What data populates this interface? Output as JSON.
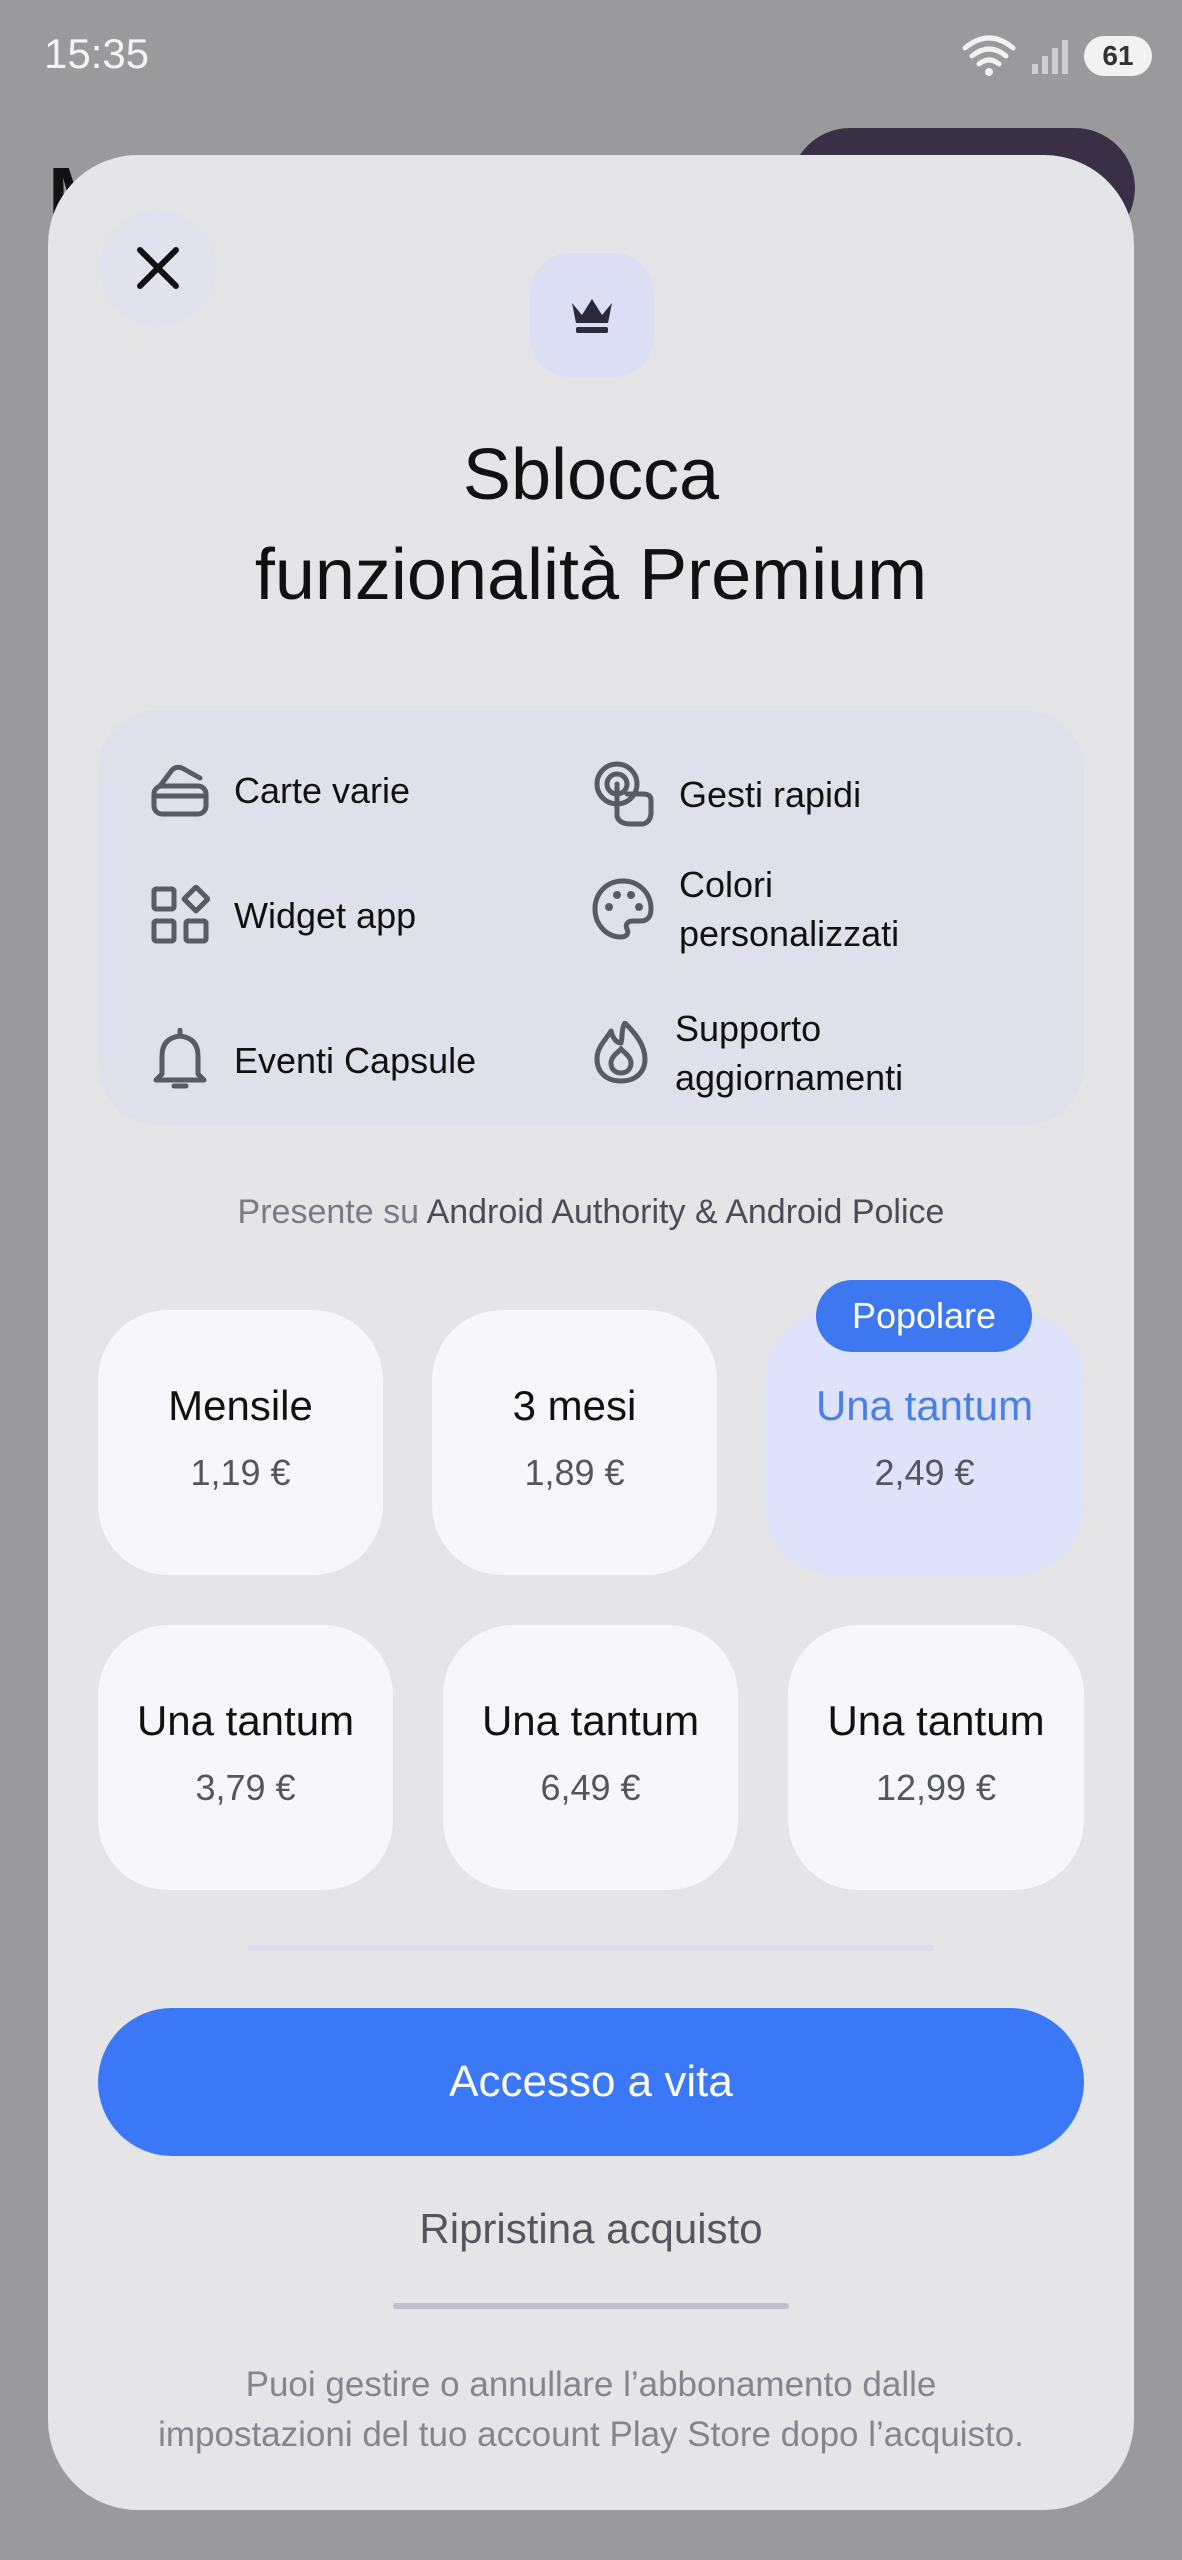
{
  "status_bar": {
    "time": "15:35",
    "battery": "61"
  },
  "sheet": {
    "headline_line1": "Sblocca",
    "headline_line2": "funzionalità Premium",
    "features": [
      {
        "icon": "cards-icon",
        "label": "Carte varie"
      },
      {
        "icon": "gesture-tap-icon",
        "label": "Gesti rapidi"
      },
      {
        "icon": "widgets-icon",
        "label": "Widget app"
      },
      {
        "icon": "palette-icon",
        "label_line1": "Colori",
        "label_line2": "personalizzati"
      },
      {
        "icon": "bell-icon",
        "label": "Eventi Capsule"
      },
      {
        "icon": "flame-icon",
        "label_line1": "Supporto",
        "label_line2": "aggiornamenti"
      }
    ],
    "press": {
      "prefix": "Presente su ",
      "names": "Android Authority & Android Police"
    },
    "badge": "Popolare",
    "plans": [
      {
        "name": "Mensile",
        "price": "1,19 €"
      },
      {
        "name": "3 mesi",
        "price": "1,89 €"
      },
      {
        "name": "Una tantum",
        "price": "2,49 €",
        "selected": true
      },
      {
        "name": "Una tantum",
        "price": "3,79 €"
      },
      {
        "name": "Una tantum",
        "price": "6,49 €"
      },
      {
        "name": "Una tantum",
        "price": "12,99 €"
      }
    ],
    "cta_label": "Accesso a vita",
    "restore_label": "Ripristina acquisto",
    "footnote_line1": "Puoi gestire o annullare l’abbonamento dalle",
    "footnote_line2": "impostazioni del tuo account Play Store dopo l’acquisto."
  },
  "colors": {
    "accent": "#3a78f8",
    "selected_plan_bg": "#dee2fb",
    "selected_plan_text": "#4a7fe6",
    "sheet_bg": "#e5e5e7"
  }
}
